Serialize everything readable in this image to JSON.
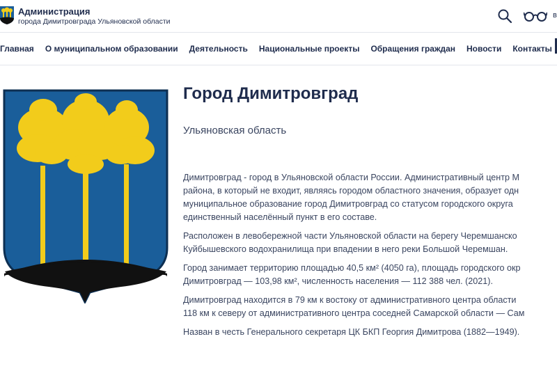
{
  "header": {
    "title": "Администрация",
    "subtitle": "города Димитровграда Ульяновской области",
    "search_icon": "search-icon",
    "accessibility_icon": "glasses-icon",
    "trail_text": "в"
  },
  "nav": {
    "items": [
      {
        "label": "Главная"
      },
      {
        "label": "О муниципальном образовании"
      },
      {
        "label": "Деятельность"
      },
      {
        "label": "Национальные проекты"
      },
      {
        "label": "Обращения граждан"
      },
      {
        "label": "Новости"
      },
      {
        "label": "Контакты"
      }
    ]
  },
  "main": {
    "title": "Город Димитровград",
    "region": "Ульяновская область",
    "paragraphs": [
      [
        "Димитровград - город в Ульяновской области России. Административный центр М",
        "района, в который не входит, являясь городом областного значения, образует одн",
        "муниципальное образование город Димитровград со статусом городского округа",
        "единственный населённый пункт в его составе."
      ],
      [
        "Расположен в левобережной части Ульяновской области на берегу Черемшанско",
        "Куйбышевского водохранилища при впадении в него реки Большой Черемшан."
      ],
      [
        "Город занимает территорию площадью 40,5 км² (4050 га), площадь городского окр",
        "Димитровград — 103,98 км², численность населения — 112 388 чел. (2021)."
      ],
      [
        "Димитровград находится в 79 км к востоку от административного центра области",
        "118 км к северу от административного центра соседней Самарской области — Сам"
      ],
      [
        "Назван в честь Генерального секретаря ЦК БКП Георгия Димитрова (1882—1949)."
      ]
    ]
  },
  "colors": {
    "navy": "#1f2c4d",
    "shield_blue": "#1a5e9a",
    "tree_gold": "#f2cc1b",
    "ground": "#111111"
  }
}
